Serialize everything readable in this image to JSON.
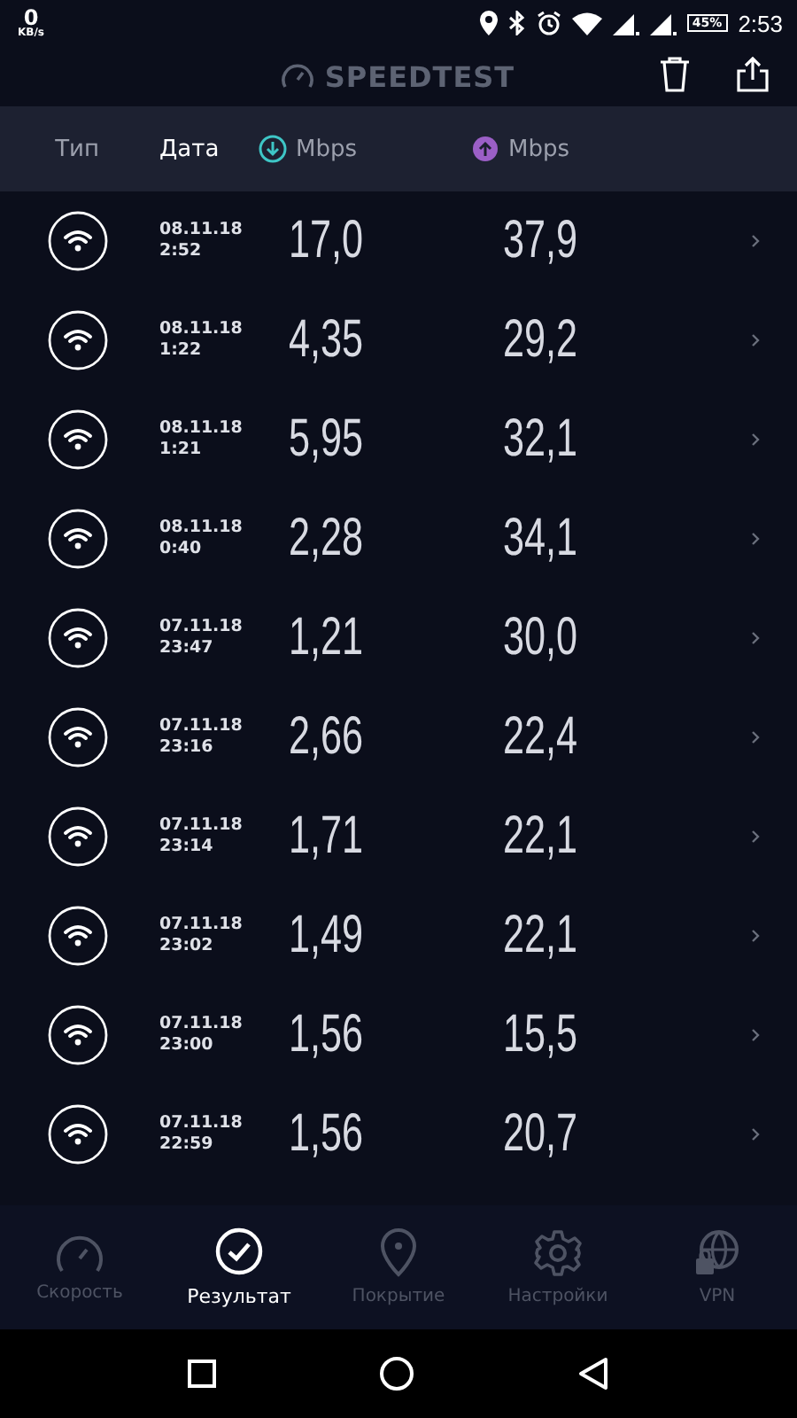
{
  "status_bar": {
    "speed_value": "0",
    "speed_unit": "KB/s",
    "battery": "45%",
    "time": "2:53"
  },
  "header": {
    "title": "SPEEDTEST"
  },
  "columns": [
    {
      "kind": "type",
      "label": "Тип"
    },
    {
      "kind": "date",
      "label": "Дата"
    },
    {
      "kind": "download",
      "label": "Mbps"
    },
    {
      "kind": "upload",
      "label": "Mbps"
    }
  ],
  "results": [
    {
      "date": "08.11.18",
      "time": "2:52",
      "download": "17,0",
      "upload": "37,9"
    },
    {
      "date": "08.11.18",
      "time": "1:22",
      "download": "4,35",
      "upload": "29,2"
    },
    {
      "date": "08.11.18",
      "time": "1:21",
      "download": "5,95",
      "upload": "32,1"
    },
    {
      "date": "08.11.18",
      "time": "0:40",
      "download": "2,28",
      "upload": "34,1"
    },
    {
      "date": "07.11.18",
      "time": "23:47",
      "download": "1,21",
      "upload": "30,0"
    },
    {
      "date": "07.11.18",
      "time": "23:16",
      "download": "2,66",
      "upload": "22,4"
    },
    {
      "date": "07.11.18",
      "time": "23:14",
      "download": "1,71",
      "upload": "22,1"
    },
    {
      "date": "07.11.18",
      "time": "23:02",
      "download": "1,49",
      "upload": "22,1"
    },
    {
      "date": "07.11.18",
      "time": "23:00",
      "download": "1,56",
      "upload": "15,5"
    },
    {
      "date": "07.11.18",
      "time": "22:59",
      "download": "1,56",
      "upload": "20,7"
    }
  ],
  "tabs": [
    {
      "kind": "speed",
      "label": "Скорость",
      "selected": false
    },
    {
      "kind": "results",
      "label": "Результат",
      "selected": true
    },
    {
      "kind": "coverage",
      "label": "Покрытие",
      "selected": false
    },
    {
      "kind": "settings",
      "label": "Настройки",
      "selected": false
    },
    {
      "kind": "vpn",
      "label": "VPN",
      "selected": false
    }
  ]
}
